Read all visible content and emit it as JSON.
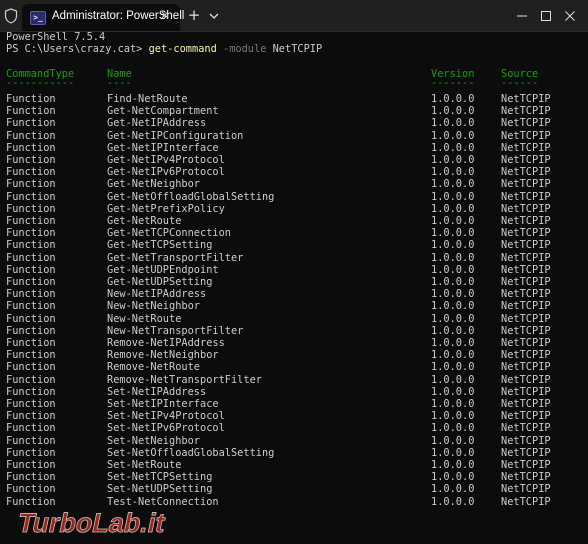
{
  "window": {
    "tab_title": "Administrator: PowerShell",
    "tab_icon_glyph": ">_",
    "close_glyph": "✕",
    "new_tab_glyph": "+",
    "icons": [
      "shield-icon",
      "powershell-icon",
      "close-icon",
      "plus-icon",
      "chevron-down-icon",
      "minimize-icon",
      "maximize-icon",
      "close-window-icon"
    ]
  },
  "terminal": {
    "version_line": "PowerShell 7.5.4",
    "prompt": "PS C:\\Users\\crazy.cat> ",
    "command": "get-command",
    "param": "-module",
    "arg": "NetTCPIP",
    "headers": [
      "CommandType",
      "Name",
      "Version",
      "Source"
    ],
    "underlines": [
      "-----------",
      "----",
      "-------",
      "------"
    ],
    "rows": [
      {
        "type": "Function",
        "name": "Find-NetRoute",
        "version": "1.0.0.0",
        "source": "NetTCPIP"
      },
      {
        "type": "Function",
        "name": "Get-NetCompartment",
        "version": "1.0.0.0",
        "source": "NetTCPIP"
      },
      {
        "type": "Function",
        "name": "Get-NetIPAddress",
        "version": "1.0.0.0",
        "source": "NetTCPIP"
      },
      {
        "type": "Function",
        "name": "Get-NetIPConfiguration",
        "version": "1.0.0.0",
        "source": "NetTCPIP"
      },
      {
        "type": "Function",
        "name": "Get-NetIPInterface",
        "version": "1.0.0.0",
        "source": "NetTCPIP"
      },
      {
        "type": "Function",
        "name": "Get-NetIPv4Protocol",
        "version": "1.0.0.0",
        "source": "NetTCPIP"
      },
      {
        "type": "Function",
        "name": "Get-NetIPv6Protocol",
        "version": "1.0.0.0",
        "source": "NetTCPIP"
      },
      {
        "type": "Function",
        "name": "Get-NetNeighbor",
        "version": "1.0.0.0",
        "source": "NetTCPIP"
      },
      {
        "type": "Function",
        "name": "Get-NetOffloadGlobalSetting",
        "version": "1.0.0.0",
        "source": "NetTCPIP"
      },
      {
        "type": "Function",
        "name": "Get-NetPrefixPolicy",
        "version": "1.0.0.0",
        "source": "NetTCPIP"
      },
      {
        "type": "Function",
        "name": "Get-NetRoute",
        "version": "1.0.0.0",
        "source": "NetTCPIP"
      },
      {
        "type": "Function",
        "name": "Get-NetTCPConnection",
        "version": "1.0.0.0",
        "source": "NetTCPIP"
      },
      {
        "type": "Function",
        "name": "Get-NetTCPSetting",
        "version": "1.0.0.0",
        "source": "NetTCPIP"
      },
      {
        "type": "Function",
        "name": "Get-NetTransportFilter",
        "version": "1.0.0.0",
        "source": "NetTCPIP"
      },
      {
        "type": "Function",
        "name": "Get-NetUDPEndpoint",
        "version": "1.0.0.0",
        "source": "NetTCPIP"
      },
      {
        "type": "Function",
        "name": "Get-NetUDPSetting",
        "version": "1.0.0.0",
        "source": "NetTCPIP"
      },
      {
        "type": "Function",
        "name": "New-NetIPAddress",
        "version": "1.0.0.0",
        "source": "NetTCPIP"
      },
      {
        "type": "Function",
        "name": "New-NetNeighbor",
        "version": "1.0.0.0",
        "source": "NetTCPIP"
      },
      {
        "type": "Function",
        "name": "New-NetRoute",
        "version": "1.0.0.0",
        "source": "NetTCPIP"
      },
      {
        "type": "Function",
        "name": "New-NetTransportFilter",
        "version": "1.0.0.0",
        "source": "NetTCPIP"
      },
      {
        "type": "Function",
        "name": "Remove-NetIPAddress",
        "version": "1.0.0.0",
        "source": "NetTCPIP"
      },
      {
        "type": "Function",
        "name": "Remove-NetNeighbor",
        "version": "1.0.0.0",
        "source": "NetTCPIP"
      },
      {
        "type": "Function",
        "name": "Remove-NetRoute",
        "version": "1.0.0.0",
        "source": "NetTCPIP"
      },
      {
        "type": "Function",
        "name": "Remove-NetTransportFilter",
        "version": "1.0.0.0",
        "source": "NetTCPIP"
      },
      {
        "type": "Function",
        "name": "Set-NetIPAddress",
        "version": "1.0.0.0",
        "source": "NetTCPIP"
      },
      {
        "type": "Function",
        "name": "Set-NetIPInterface",
        "version": "1.0.0.0",
        "source": "NetTCPIP"
      },
      {
        "type": "Function",
        "name": "Set-NetIPv4Protocol",
        "version": "1.0.0.0",
        "source": "NetTCPIP"
      },
      {
        "type": "Function",
        "name": "Set-NetIPv6Protocol",
        "version": "1.0.0.0",
        "source": "NetTCPIP"
      },
      {
        "type": "Function",
        "name": "Set-NetNeighbor",
        "version": "1.0.0.0",
        "source": "NetTCPIP"
      },
      {
        "type": "Function",
        "name": "Set-NetOffloadGlobalSetting",
        "version": "1.0.0.0",
        "source": "NetTCPIP"
      },
      {
        "type": "Function",
        "name": "Set-NetRoute",
        "version": "1.0.0.0",
        "source": "NetTCPIP"
      },
      {
        "type": "Function",
        "name": "Set-NetTCPSetting",
        "version": "1.0.0.0",
        "source": "NetTCPIP"
      },
      {
        "type": "Function",
        "name": "Set-NetUDPSetting",
        "version": "1.0.0.0",
        "source": "NetTCPIP"
      },
      {
        "type": "Function",
        "name": "Test-NetConnection",
        "version": "1.0.0.0",
        "source": "NetTCPIP"
      }
    ]
  },
  "watermark": {
    "text": "TurboLab.it"
  },
  "colors": {
    "background": "#0c0c0c",
    "text": "#cccccc",
    "header_green": "#13a10e",
    "command_yellow": "#f9f1a5",
    "param_gray": "#767676",
    "titlebar": "#202020",
    "watermark_red": "#d42a1c"
  }
}
